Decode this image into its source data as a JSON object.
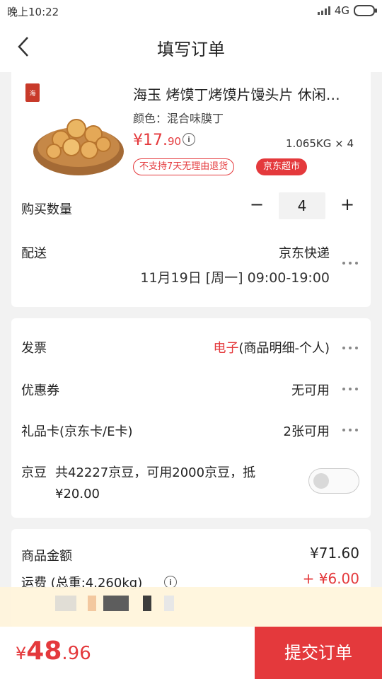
{
  "status_bar": {
    "time": "晚上10:22",
    "network": "4G"
  },
  "nav": {
    "title": "填写订单"
  },
  "product": {
    "title": "海玉 烤馍丁烤馍片馒头片 休闲…",
    "variant": "颜色：混合味膜丁",
    "price_int": "¥17.",
    "price_dec": "90",
    "weight_qty": "1.065KG × 4",
    "tag_no_return": "不支持7天无理由退货",
    "tag_market": "京东超市"
  },
  "quantity": {
    "label": "购买数量",
    "minus": "−",
    "value": "4",
    "plus": "+"
  },
  "shipping": {
    "label": "配送",
    "method": "京东快递",
    "time": "11月19日 [周一] 09:00-19:00"
  },
  "invoice": {
    "label": "发票",
    "type": "电子",
    "detail": "(商品明细-个人)"
  },
  "coupon": {
    "label": "优惠券",
    "value": "无可用"
  },
  "gift_card": {
    "label": "礼品卡(京东卡/E卡)",
    "value": "2张可用"
  },
  "jd_beans": {
    "label": "京豆",
    "text": "共42227京豆，可用2000京豆，抵¥20.00",
    "enabled": false
  },
  "summary": {
    "goods_label": "商品金额",
    "goods_value": "¥71.60",
    "freight_label": "运费 (总重:4.260kg)",
    "freight_value": "+ ¥6.00"
  },
  "footer": {
    "currency": "¥",
    "total_int": "48",
    "total_dec": ".96",
    "submit": "提交订单"
  },
  "colors": {
    "accent": "#e4393c",
    "background": "#f2f2f2"
  }
}
